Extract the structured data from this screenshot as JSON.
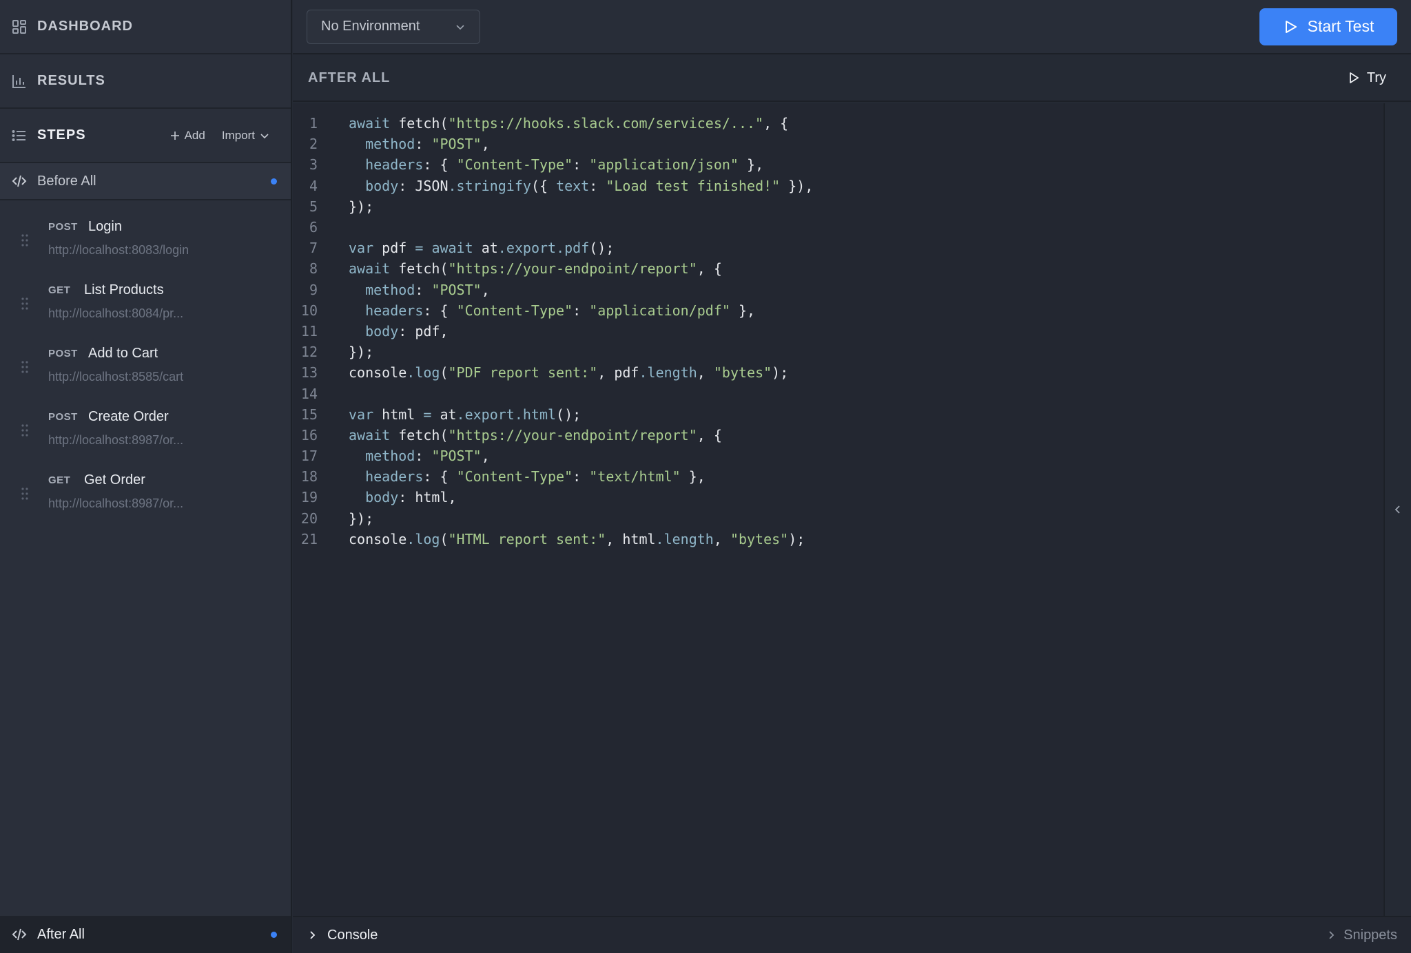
{
  "sidebar": {
    "dashboard_label": "DASHBOARD",
    "results_label": "RESULTS",
    "steps_label": "STEPS",
    "add_label": "Add",
    "import_label": "Import",
    "before_all_label": "Before All",
    "after_all_label": "After All",
    "steps": [
      {
        "method": "POST",
        "name": "Login",
        "url": "http://localhost:8083/login"
      },
      {
        "method": "GET",
        "name": "List Products",
        "url": "http://localhost:8084/pr..."
      },
      {
        "method": "POST",
        "name": "Add to Cart",
        "url": "http://localhost:8585/cart"
      },
      {
        "method": "POST",
        "name": "Create Order",
        "url": "http://localhost:8987/or..."
      },
      {
        "method": "GET",
        "name": "Get Order",
        "url": "http://localhost:8987/or..."
      }
    ]
  },
  "topbar": {
    "environment_value": "No Environment",
    "start_label": "Start Test"
  },
  "section": {
    "title": "AFTER ALL",
    "try_label": "Try"
  },
  "editor": {
    "line_numbers": [
      "1",
      "2",
      "3",
      "4",
      "5",
      "6",
      "7",
      "8",
      "9",
      "10",
      "11",
      "12",
      "13",
      "14",
      "15",
      "16",
      "17",
      "18",
      "19",
      "20",
      "21"
    ]
  },
  "bottom": {
    "console_label": "Console",
    "snippets_label": "Snippets"
  },
  "colors": {
    "accent": "#3b82f6",
    "sidebar_bg": "#2a2f3a",
    "editor_bg": "#232731",
    "string": "#a9cc8f",
    "keyword": "#8fb6c9"
  }
}
